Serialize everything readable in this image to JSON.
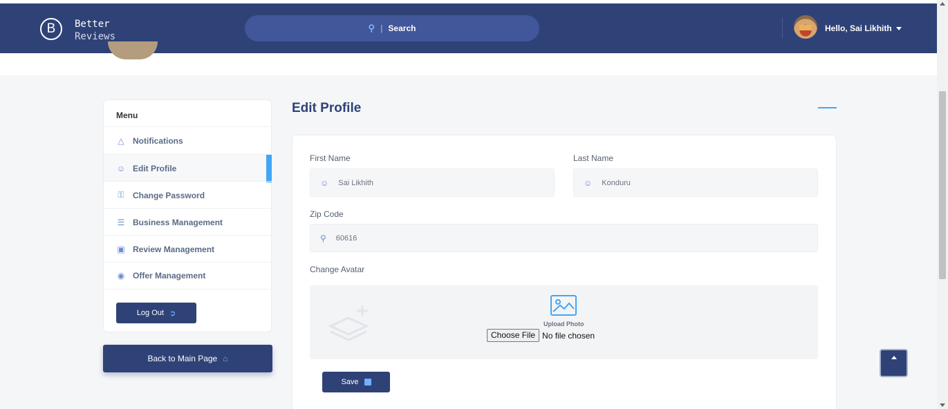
{
  "app": {
    "logo_letter": "B",
    "name_line1": "Better",
    "name_line2": "Reviews"
  },
  "header": {
    "search_label": "Search",
    "search_separator": "|",
    "greeting": "Hello,  Sai Likhith"
  },
  "sidebar": {
    "menu_title": "Menu",
    "items": [
      {
        "label": "Notifications",
        "icon": "bell-icon"
      },
      {
        "label": "Edit Profile",
        "icon": "user-edit-icon",
        "active": true
      },
      {
        "label": "Change Password",
        "icon": "key-icon"
      },
      {
        "label": "Business Management",
        "icon": "list-icon"
      },
      {
        "label": "Review Management",
        "icon": "chat-icon"
      },
      {
        "label": "Offer Management",
        "icon": "offer-icon"
      }
    ],
    "logout_label": "Log Out",
    "back_label": "Back to Main Page"
  },
  "main": {
    "title": "Edit Profile",
    "first_name_label": "First Name",
    "first_name_value": "Sai Likhith",
    "last_name_label": "Last Name",
    "last_name_value": "Konduru",
    "zip_label": "Zip Code",
    "zip_value": "60616",
    "avatar_label": "Change Avatar",
    "upload_label": "Upload Photo",
    "choose_file_label": "Choose File",
    "no_file_text": "No file chosen",
    "save_label": "Save"
  },
  "colors": {
    "navbar": "#2f4277",
    "accent": "#42a5f5",
    "search_bg": "#42569a"
  }
}
